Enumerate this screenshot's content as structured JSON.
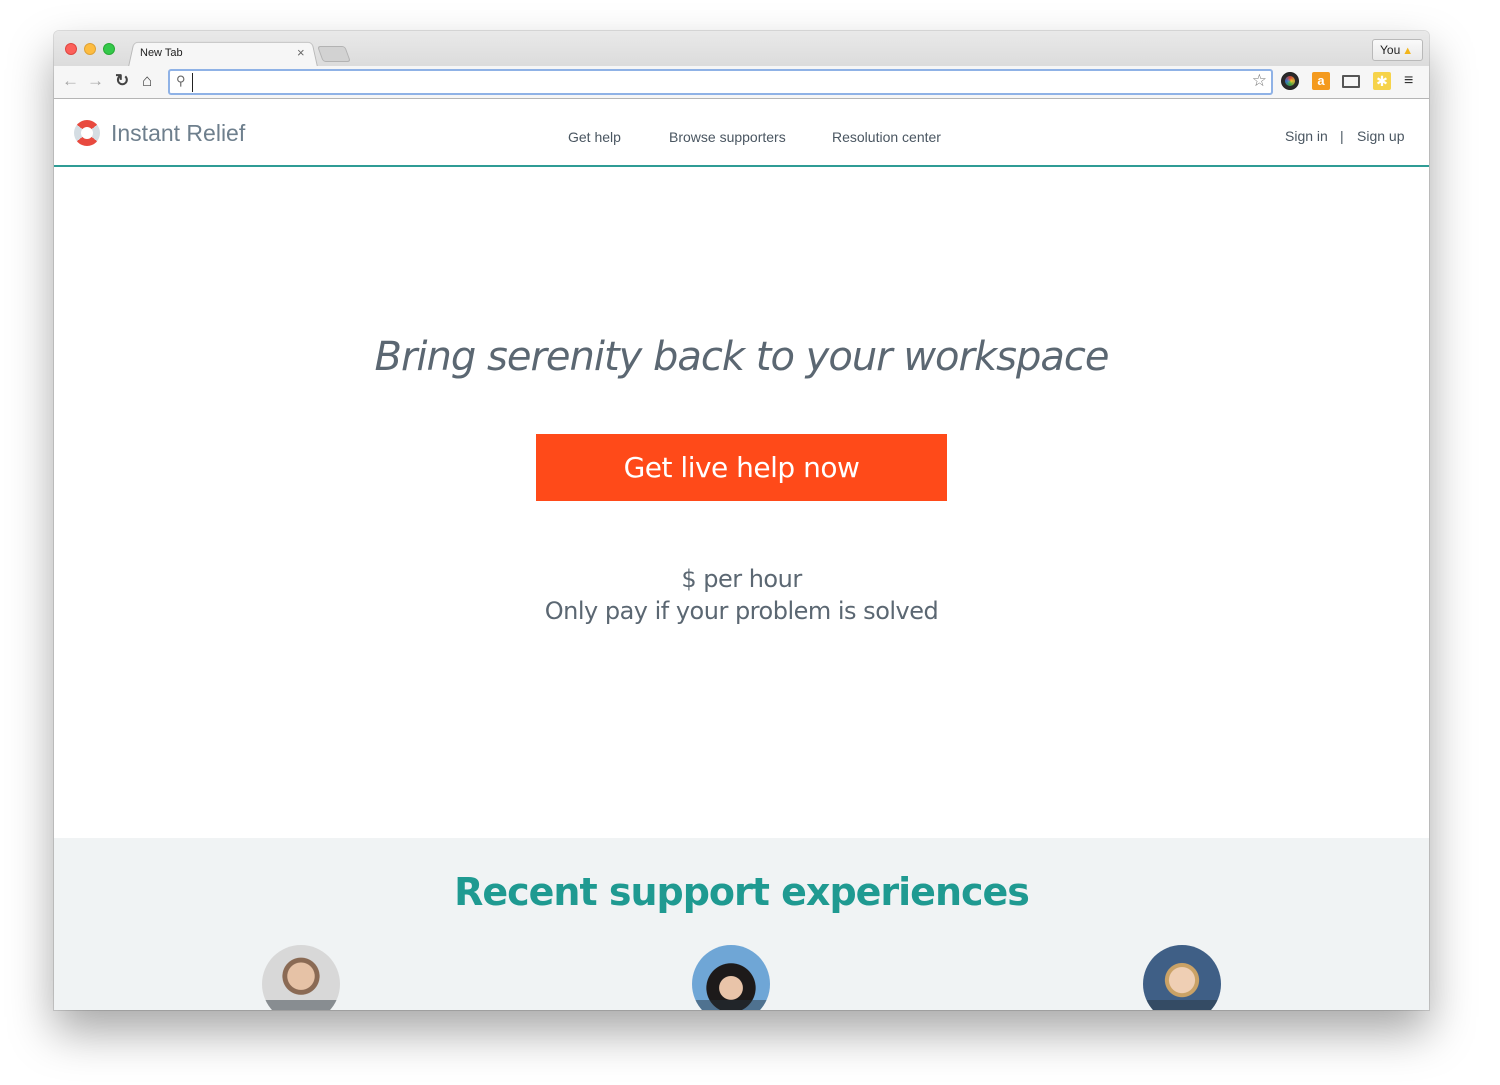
{
  "browser": {
    "tab_title": "New Tab",
    "tab_close": "×",
    "profile_label": "You",
    "profile_warning_icon": "warning-icon",
    "address_value": "",
    "icons": {
      "back": "←",
      "forward": "→",
      "reload": "↻",
      "home": "⌂",
      "search": "⚲",
      "star": "☆",
      "amazon": "a",
      "menu": "≡"
    }
  },
  "site": {
    "logo_text": "Instant Relief",
    "nav": [
      "Get help",
      "Browse supporters",
      "Resolution center"
    ],
    "auth": {
      "sign_in": "Sign in",
      "separator": "|",
      "sign_up": "Sign up"
    },
    "hero": {
      "title": "Bring serenity back to your workspace",
      "cta_label": "Get live help now",
      "price": "$ per hour",
      "price_note": "Only pay if your problem is solved"
    },
    "experiences": {
      "title": "Recent support experiences"
    }
  },
  "colors": {
    "accent_teal": "#1f9a91",
    "cta_orange": "#ff4a19",
    "text_slate": "#5b6772",
    "section_bg": "#f0f3f4",
    "logo_red": "#e84a3f"
  }
}
